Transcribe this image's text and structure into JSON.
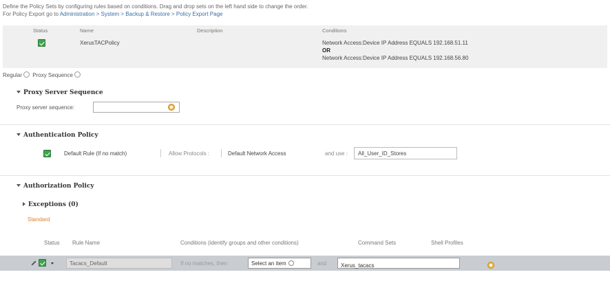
{
  "intro": {
    "line1": "Define the Policy Sets by configuring rules based on conditions. Drag and drop sets on the left hand side to change the order.",
    "line2_prefix": "For Policy Export go to ",
    "line2_link": "Administration > System > Backup & Restore > Policy Export Page"
  },
  "policy_set": {
    "headers": {
      "status": "Status",
      "name": "Name",
      "description": "Description",
      "conditions": "Conditions"
    },
    "name": "XerusTACPolicy",
    "description": "",
    "condition1": "Network Access:Device IP Address EQUALS 192.168.51.11",
    "operator": "OR",
    "condition2": "Network Access:Device IP Address EQUALS 192.168.56.80"
  },
  "mode": {
    "regular": "Regular",
    "proxy": "Proxy Sequence"
  },
  "proxy": {
    "title": "Proxy Server Sequence",
    "label": "Proxy server sequence:",
    "value": ""
  },
  "authentication": {
    "title": "Authentication Policy",
    "rule": "Default Rule (If no match)",
    "allow_label": "Allow Protocols :",
    "allow_value": "Default Network Access",
    "use_label": "and use :",
    "use_value": "All_User_ID_Stores"
  },
  "authorization": {
    "title": "Authorization Policy",
    "exceptions": "Exceptions (0)",
    "standard": "Standard",
    "headers": {
      "status": "Status",
      "rule_name": "Rule Name",
      "conditions": "Conditions (identify groups and other conditions)",
      "command_sets": "Command Sets",
      "shell_profiles": "Shell Profiles"
    },
    "row": {
      "rule_name": "Tacacs_Default",
      "if_text": "If no matches, then",
      "select_placeholder": "Select an item",
      "and_text": "and",
      "command_set": "Xerus_tacacs",
      "shell_profile": ""
    }
  },
  "colors": {
    "check_green": "#3fa34d",
    "link_blue": "#3a6ea5",
    "standard_orange": "#d9822b",
    "row_highlight": "#c9cdd2"
  }
}
